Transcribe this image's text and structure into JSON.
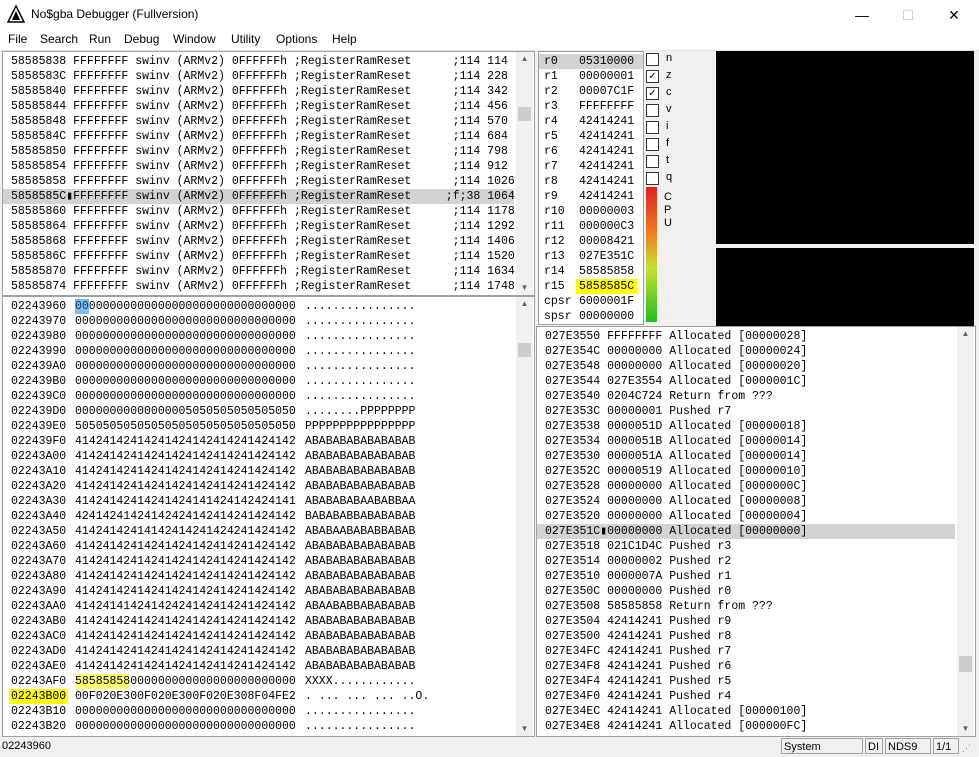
{
  "title": "No$gba Debugger (Fullversion)",
  "window_controls": {
    "minimize": "—",
    "maximize": "☐",
    "close": "✕"
  },
  "menu": [
    "File",
    "Search",
    "Run",
    "Debug",
    "Window",
    "Utility",
    "Options",
    "Help"
  ],
  "disasm": [
    "58585838 FFFFFFFF swinv (ARMv2) 0FFFFFFh ;RegisterRamReset      ;114 114",
    "5858583C FFFFFFFF swinv (ARMv2) 0FFFFFFh ;RegisterRamReset      ;114 228",
    "58585840 FFFFFFFF swinv (ARMv2) 0FFFFFFh ;RegisterRamReset      ;114 342",
    "58585844 FFFFFFFF swinv (ARMv2) 0FFFFFFh ;RegisterRamReset      ;114 456",
    "58585848 FFFFFFFF swinv (ARMv2) 0FFFFFFh ;RegisterRamReset      ;114 570",
    "5858584C FFFFFFFF swinv (ARMv2) 0FFFFFFh ;RegisterRamReset      ;114 684",
    "58585850 FFFFFFFF swinv (ARMv2) 0FFFFFFh ;RegisterRamReset      ;114 798",
    "58585854 FFFFFFFF swinv (ARMv2) 0FFFFFFh ;RegisterRamReset      ;114 912",
    "58585858 FFFFFFFF swinv (ARMv2) 0FFFFFFh ;RegisterRamReset      ;114 1026",
    "5858585C▮FFFFFFFF swinv (ARMv2) 0FFFFFFh ;RegisterRamReset     ;f;38 1064",
    "58585860 FFFFFFFF swinv (ARMv2) 0FFFFFFh ;RegisterRamReset      ;114 1178",
    "58585864 FFFFFFFF swinv (ARMv2) 0FFFFFFh ;RegisterRamReset      ;114 1292",
    "58585868 FFFFFFFF swinv (ARMv2) 0FFFFFFh ;RegisterRamReset      ;114 1406",
    "5858586C FFFFFFFF swinv (ARMv2) 0FFFFFFh ;RegisterRamReset      ;114 1520",
    "58585870 FFFFFFFF swinv (ARMv2) 0FFFFFFh ;RegisterRamReset      ;114 1634",
    "58585874 FFFFFFFF swinv (ARMv2) 0FFFFFFh ;RegisterRamReset      ;114 1748"
  ],
  "disasm_selected": 9,
  "registers": [
    {
      "name": "r0",
      "value": "05310000"
    },
    {
      "name": "r1",
      "value": "00000001"
    },
    {
      "name": "r2",
      "value": "00007C1F"
    },
    {
      "name": "r3",
      "value": "FFFFFFFF"
    },
    {
      "name": "r4",
      "value": "42414241"
    },
    {
      "name": "r5",
      "value": "42414241"
    },
    {
      "name": "r6",
      "value": "42414241"
    },
    {
      "name": "r7",
      "value": "42414241"
    },
    {
      "name": "r8",
      "value": "42414241"
    },
    {
      "name": "r9",
      "value": "42414241"
    },
    {
      "name": "r10",
      "value": "00000003"
    },
    {
      "name": "r11",
      "value": "000000C3"
    },
    {
      "name": "r12",
      "value": "00008421"
    },
    {
      "name": "r13",
      "value": "027E351C"
    },
    {
      "name": "r14",
      "value": "58585858"
    },
    {
      "name": "r15",
      "value": "5858585C"
    },
    {
      "name": "cpsr",
      "value": "6000001F"
    },
    {
      "name": "spsr",
      "value": "00000000"
    }
  ],
  "flags": [
    {
      "label": "n",
      "checked": false
    },
    {
      "label": "z",
      "checked": true
    },
    {
      "label": "c",
      "checked": true
    },
    {
      "label": "v",
      "checked": false
    },
    {
      "label": "i",
      "checked": false
    },
    {
      "label": "f",
      "checked": false
    },
    {
      "label": "t",
      "checked": false
    },
    {
      "label": "q",
      "checked": false
    }
  ],
  "cpu_label": [
    "C",
    "P",
    "U"
  ],
  "cpu_load": 0.6,
  "memory": [
    {
      "addr": "02243960",
      "hex": "00000000000000000000000000000000",
      "ascii": "................"
    },
    {
      "addr": "02243970",
      "hex": "00000000000000000000000000000000",
      "ascii": "................"
    },
    {
      "addr": "02243980",
      "hex": "00000000000000000000000000000000",
      "ascii": "................"
    },
    {
      "addr": "02243990",
      "hex": "00000000000000000000000000000000",
      "ascii": "................"
    },
    {
      "addr": "022439A0",
      "hex": "00000000000000000000000000000000",
      "ascii": "................"
    },
    {
      "addr": "022439B0",
      "hex": "00000000000000000000000000000000",
      "ascii": "................"
    },
    {
      "addr": "022439C0",
      "hex": "00000000000000000000000000000000",
      "ascii": "................"
    },
    {
      "addr": "022439D0",
      "hex": "00000000000000005050505050505050",
      "ascii": "........PPPPPPPP"
    },
    {
      "addr": "022439E0",
      "hex": "50505050505050505050505050505050",
      "ascii": "PPPPPPPPPPPPPPPP"
    },
    {
      "addr": "022439F0",
      "hex": "41424142414241424142414241424142",
      "ascii": "ABABABABABABABAB"
    },
    {
      "addr": "02243A00",
      "hex": "41424142414241424142414241424142",
      "ascii": "ABABABABABABABAB"
    },
    {
      "addr": "02243A10",
      "hex": "41424142414241424142414241424142",
      "ascii": "ABABABABABABABAB"
    },
    {
      "addr": "02243A20",
      "hex": "41424142414241424142414241424142",
      "ascii": "ABABABABABABABAB"
    },
    {
      "addr": "02243A30",
      "hex": "41424142414241424141424142424141",
      "ascii": "ABABABABAABABBAA"
    },
    {
      "addr": "02243A40",
      "hex": "42414241424142424142414241424142",
      "ascii": "BABABABBABABABAB"
    },
    {
      "addr": "02243A50",
      "hex": "41424142414142414241424241424142",
      "ascii": "ABABAABABABBABAB"
    },
    {
      "addr": "02243A60",
      "hex": "41424142414241424142414241424142",
      "ascii": "ABABABABABABABAB"
    },
    {
      "addr": "02243A70",
      "hex": "41424142414241424142414241424142",
      "ascii": "ABABABABABABABAB"
    },
    {
      "addr": "02243A80",
      "hex": "41424142414241424142414241424142",
      "ascii": "ABABABABABABABAB"
    },
    {
      "addr": "02243A90",
      "hex": "41424142414241424142414241424142",
      "ascii": "ABABABABABABABAB"
    },
    {
      "addr": "02243AA0",
      "hex": "41424141424142424142414241424142",
      "ascii": "ABAABABBABABABAB"
    },
    {
      "addr": "02243AB0",
      "hex": "41424142414241424142414241424142",
      "ascii": "ABABABABABABABAB"
    },
    {
      "addr": "02243AC0",
      "hex": "41424142414241424142414241424142",
      "ascii": "ABABABABABABABAB"
    },
    {
      "addr": "02243AD0",
      "hex": "41424142414241424142414241424142",
      "ascii": "ABABABABABABABAB"
    },
    {
      "addr": "02243AE0",
      "hex": "41424142414241424142414241424142",
      "ascii": "ABABABABABABABAB"
    },
    {
      "addr": "02243AF0",
      "hex": "58585858000000000000000000000000",
      "ascii": "XXXX............"
    },
    {
      "addr": "02243B00",
      "hex": "00F020E300F020E300F020E308F04FE2",
      "ascii": ". ... ... ... ..O."
    },
    {
      "addr": "02243B10",
      "hex": "00000000000000000000000000000000",
      "ascii": "................"
    },
    {
      "addr": "02243B20",
      "hex": "00000000000000000000000000000000",
      "ascii": "................"
    }
  ],
  "stack": [
    "027E3550 FFFFFFFF Allocated [00000028]",
    "027E354C 00000000 Allocated [00000024]",
    "027E3548 00000000 Allocated [00000020]",
    "027E3544 027E3554 Allocated [0000001C]",
    "027E3540 0204C724 Return from ???",
    "027E353C 00000001 Pushed r7",
    "027E3538 0000051D Allocated [00000018]",
    "027E3534 0000051B Allocated [00000014]",
    "027E3530 0000051A Allocated [00000014]",
    "027E352C 00000519 Allocated [00000010]",
    "027E3528 00000000 Allocated [0000000C]",
    "027E3524 00000000 Allocated [00000008]",
    "027E3520 00000000 Allocated [00000004]",
    "027E351C▮00000000 Allocated [00000000]",
    "027E3518 021C1D4C Pushed r3",
    "027E3514 00000002 Pushed r2",
    "027E3510 0000007A Pushed r1",
    "027E350C 00000000 Pushed r0",
    "027E3508 58585858 Return from ???",
    "027E3504 42414241 Pushed r9",
    "027E3500 42414241 Pushed r8",
    "027E34FC 42414241 Pushed r7",
    "027E34F8 42414241 Pushed r6",
    "027E34F4 42414241 Pushed r5",
    "027E34F0 42414241 Pushed r4",
    "027E34EC 42414241 Allocated [00000100]",
    "027E34E8 42414241 Allocated [000000FC]"
  ],
  "stack_selected": 13,
  "status": {
    "address": "02243960",
    "mode": "System",
    "di": "DI",
    "core": "NDS9",
    "page": "1/1"
  },
  "colors": {
    "highlight": "#ffff00",
    "selected_row": "#d3d3d3",
    "screen": "#000000",
    "cursor": "#0078d7"
  }
}
